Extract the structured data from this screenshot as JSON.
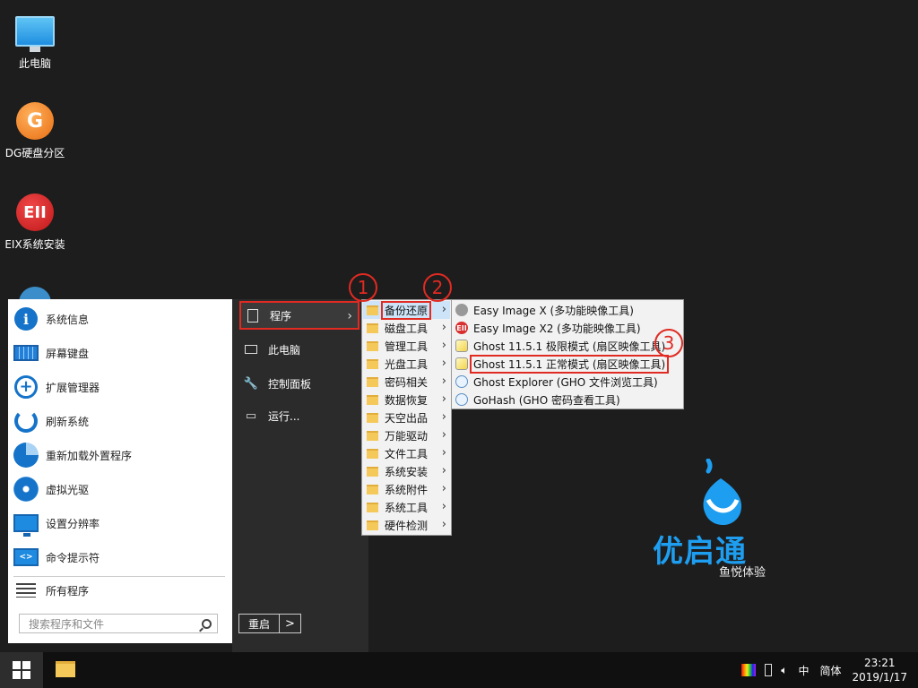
{
  "desktop": {
    "icons": [
      {
        "label": "此电脑"
      },
      {
        "label": "DG硬盘分区",
        "glyph": "G"
      },
      {
        "label": "EIX系统安装",
        "glyph": "EII"
      }
    ]
  },
  "start_menu": {
    "left_items": [
      {
        "label": "系统信息",
        "icon": "info-icon"
      },
      {
        "label": "屏幕键盘",
        "icon": "keyboard-icon"
      },
      {
        "label": "扩展管理器",
        "icon": "plus-circle-icon"
      },
      {
        "label": "刷新系统",
        "icon": "refresh-icon"
      },
      {
        "label": "重新加载外置程序",
        "icon": "pie-icon"
      },
      {
        "label": "虚拟光驱",
        "icon": "disc-icon"
      },
      {
        "label": "设置分辨率",
        "icon": "monitor-icon"
      },
      {
        "label": "命令提示符",
        "icon": "cmd-icon"
      }
    ],
    "all_programs": "所有程序",
    "search_placeholder": "搜索程序和文件",
    "mid_items": [
      {
        "label": "程序",
        "icon": "document-icon"
      },
      {
        "label": "此电脑",
        "icon": "computer-icon"
      },
      {
        "label": "控制面板",
        "icon": "wrench-icon"
      },
      {
        "label": "运行...",
        "icon": "run-icon"
      }
    ],
    "restart_label": "重启",
    "restart_arrow": ">"
  },
  "submenu1": {
    "items": [
      {
        "label": "备份还原"
      },
      {
        "label": "磁盘工具"
      },
      {
        "label": "管理工具"
      },
      {
        "label": "光盘工具"
      },
      {
        "label": "密码相关"
      },
      {
        "label": "数据恢复"
      },
      {
        "label": "天空出品"
      },
      {
        "label": "万能驱动"
      },
      {
        "label": "文件工具"
      },
      {
        "label": "系统安装"
      },
      {
        "label": "系统附件"
      },
      {
        "label": "系统工具"
      },
      {
        "label": "硬件检测"
      }
    ]
  },
  "submenu2": {
    "items": [
      {
        "label": "Easy Image X (多功能映像工具)",
        "icon": "easyimage-icon"
      },
      {
        "label": "Easy Image X2 (多功能映像工具)",
        "icon": "easyimage2-icon",
        "glyph": "EII"
      },
      {
        "label": "Ghost 11.5.1 极限模式 (扇区映像工具)",
        "icon": "ghost-icon"
      },
      {
        "label": "Ghost 11.5.1 正常模式 (扇区映像工具)",
        "icon": "ghost-icon"
      },
      {
        "label": "Ghost Explorer (GHO 文件浏览工具)",
        "icon": "ghost-explorer-icon"
      },
      {
        "label": "GoHash (GHO 密码查看工具)",
        "icon": "gohash-icon"
      }
    ]
  },
  "callouts": [
    "1",
    "2",
    "3"
  ],
  "logo": {
    "brand": "优启通",
    "slogan": "鱼悦体验"
  },
  "taskbar": {
    "ime": "中",
    "lang": "简体",
    "time": "23:21",
    "date": "2019/1/17"
  },
  "colors": {
    "accent": "#e02a22",
    "brand": "#1e9ef0"
  }
}
